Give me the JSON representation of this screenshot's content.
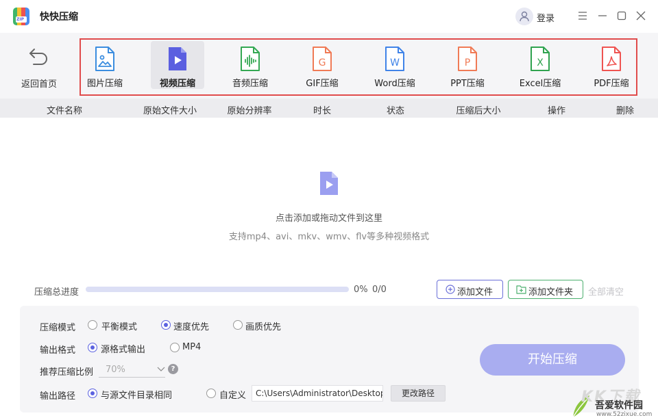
{
  "app": {
    "title": "快快压缩",
    "logo_text": "ZIP",
    "login_label": "登录"
  },
  "toolbar": {
    "back_label": "返回首页",
    "tools": [
      {
        "label": "图片压缩",
        "icon": "image-file-icon",
        "color": "#3b8ddf"
      },
      {
        "label": "视频压缩",
        "icon": "video-file-icon",
        "color": "#5b5fe0",
        "active": true
      },
      {
        "label": "音频压缩",
        "icon": "audio-file-icon",
        "color": "#33a852"
      },
      {
        "label": "GIF压缩",
        "icon": "gif-file-icon",
        "color": "#f07a55",
        "glyph": "G"
      },
      {
        "label": "Word压缩",
        "icon": "word-file-icon",
        "color": "#3f83e8",
        "glyph": "W"
      },
      {
        "label": "PPT压缩",
        "icon": "ppt-file-icon",
        "color": "#f07a55",
        "glyph": "P"
      },
      {
        "label": "Excel压缩",
        "icon": "excel-file-icon",
        "color": "#2fa34f",
        "glyph": "X"
      },
      {
        "label": "PDF压缩",
        "icon": "pdf-file-icon",
        "color": "#ef5350"
      }
    ]
  },
  "table": {
    "headers": [
      "文件名称",
      "原始文件大小",
      "原始分辨率",
      "时长",
      "状态",
      "压缩后大小",
      "操作",
      "删除"
    ]
  },
  "drop": {
    "main": "点击添加或拖动文件到这里",
    "sub": "支持mp4、avi、mkv、wmv、flv等多种视频格式"
  },
  "progress": {
    "label": "压缩总进度",
    "percent_text": "0%",
    "count_text": "0/0",
    "value": 0
  },
  "actions": {
    "add_file": "添加文件",
    "add_folder": "添加文件夹",
    "clear_all": "全部清空"
  },
  "settings": {
    "mode_label": "压缩模式",
    "modes": [
      {
        "label": "平衡模式",
        "selected": false
      },
      {
        "label": "速度优先",
        "selected": true
      },
      {
        "label": "画质优先",
        "selected": false
      }
    ],
    "format_label": "输出格式",
    "formats": [
      {
        "label": "源格式输出",
        "selected": true
      },
      {
        "label": "MP4",
        "selected": false
      }
    ],
    "ratio_label": "推荐压缩比例",
    "ratio_value": "70%",
    "help_glyph": "?",
    "path_label": "输出路径",
    "path_options": [
      {
        "label": "与源文件目录相同",
        "selected": true
      },
      {
        "label": "自定义",
        "selected": false
      }
    ],
    "path_value": "C:\\Users\\Administrator\\Desktop",
    "change_path": "更改路径",
    "start": "开始压缩"
  },
  "watermark": {
    "big": "KK下载",
    "name": "吾爱软件园",
    "url": "www.52zixue.com"
  },
  "colors": {
    "accent": "#5b62e0",
    "frame": "#e04b4b",
    "start_bg": "#a9adf0"
  }
}
